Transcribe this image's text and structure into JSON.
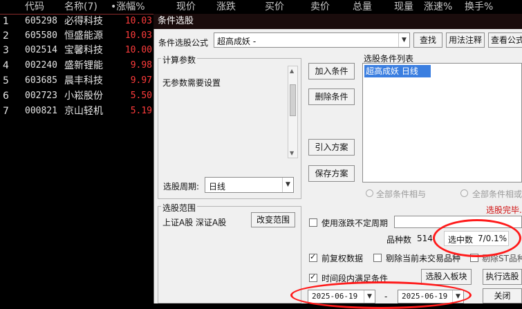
{
  "header": {
    "code": "代码",
    "name": "名称(7)",
    "change_pct": "•涨幅%",
    "price": "现价",
    "change": "涨跌",
    "bid": "买价",
    "ask": "卖价",
    "volume": "总量",
    "current_vol": "现量",
    "speed": "涨速%",
    "turnover": "换手%"
  },
  "stocks": [
    {
      "idx": "1",
      "code": "605298",
      "name": "必得科技",
      "pct": "10.03"
    },
    {
      "idx": "2",
      "code": "605580",
      "name": "恒盛能源",
      "pct": "10.03"
    },
    {
      "idx": "3",
      "code": "002514",
      "name": "宝馨科技",
      "pct": "10.00"
    },
    {
      "idx": "4",
      "code": "002240",
      "name": "盛新锂能",
      "pct": "9.98"
    },
    {
      "idx": "5",
      "code": "603685",
      "name": "晨丰科技",
      "pct": "9.97"
    },
    {
      "idx": "6",
      "code": "002723",
      "name": "小崧股份",
      "pct": "5.50"
    },
    {
      "idx": "7",
      "code": "000821",
      "name": "京山轻机",
      "pct": "5.19"
    }
  ],
  "dialog": {
    "title": "条件选股",
    "formula_label": "条件选股公式",
    "formula_value": "超高成妖  -",
    "find_btn": "查找",
    "usage_btn": "用法注释",
    "view_btn": "查看公式",
    "params_title": "计算参数",
    "params_text": "无参数需要设置",
    "add_cond_btn": "加入条件",
    "del_cond_btn": "删除条件",
    "import_btn": "引入方案",
    "save_btn": "保存方案",
    "cond_list_title": "选股条件列表",
    "cond_item": "超高成妖  日线",
    "radio_and": "全部条件相与",
    "radio_or": "全部条件相或",
    "done_text": "选股完毕.",
    "period_label": "选股周期:",
    "period_value": "日线",
    "range_title": "选股范围",
    "range_text": "上证A股 深证A股",
    "change_range_btn": "改变范围",
    "irregular_period": "使用涨跌不定周期",
    "count_label": "品种数",
    "count_value": "514",
    "selected_label": "选中数",
    "selected_value": "7/0.1%",
    "adj_data": "前复权数据",
    "exclude_untraded": "剔除当前未交易品种",
    "exclude_st": "剔除ST品种",
    "period_cond": "时间段内满足条件",
    "to_board_btn": "选股入板块",
    "run_btn": "执行选股",
    "date_from": "2025-06-19",
    "date_sep": "-",
    "date_to": "2025-06-19",
    "close_btn": "关闭"
  }
}
